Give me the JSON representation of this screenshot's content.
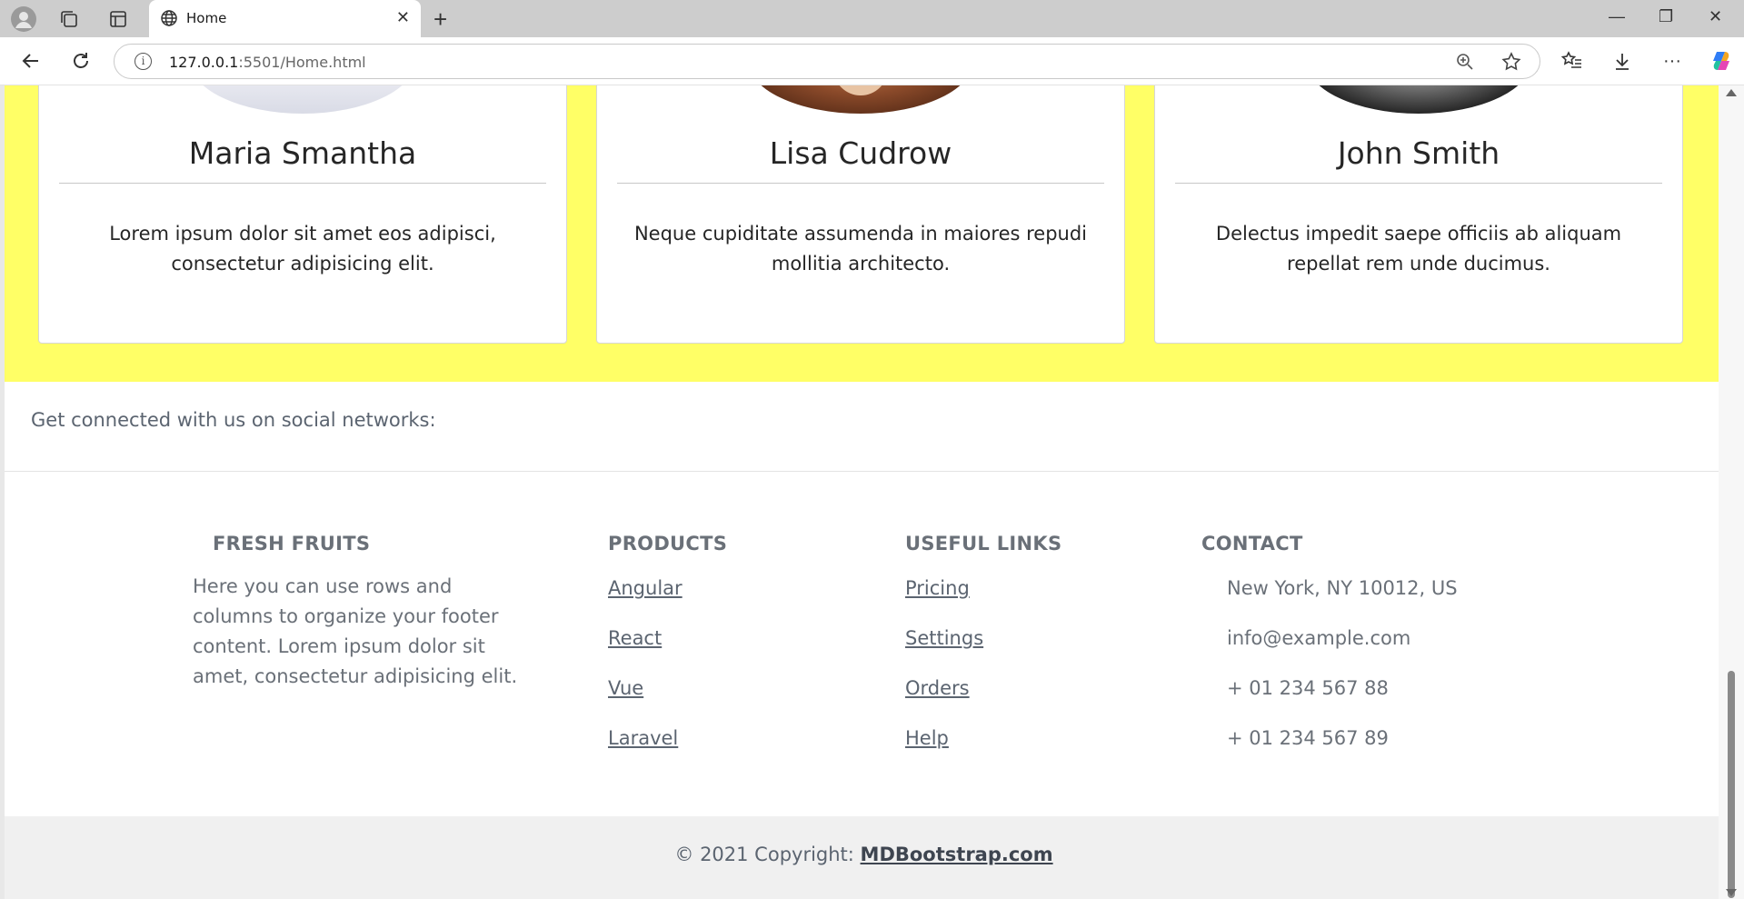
{
  "browser": {
    "tab_title": "Home",
    "url_host": "127.0.0.1",
    "url_rest": ":5501/Home.html"
  },
  "testimonials": [
    {
      "name": "Maria Smantha",
      "text": "Lorem ipsum dolor sit amet eos adipisci, consectetur adipisicing elit."
    },
    {
      "name": "Lisa Cudrow",
      "text": "Neque cupiditate assumenda in maiores repudi mollitia architecto."
    },
    {
      "name": "John Smith",
      "text": "Delectus impedit saepe officiis ab aliquam repellat rem unde ducimus."
    }
  ],
  "social": {
    "text": "Get connected with us on social networks:"
  },
  "footer": {
    "brand": {
      "heading": "FRESH FRUITS",
      "text": "Here you can use rows and columns to organize your footer content. Lorem ipsum dolor sit amet, consectetur adipisicing elit."
    },
    "products": {
      "heading": "PRODUCTS",
      "links": [
        "Angular",
        "React",
        "Vue",
        "Laravel"
      ]
    },
    "useful": {
      "heading": "USEFUL LINKS",
      "links": [
        "Pricing",
        "Settings",
        "Orders",
        "Help"
      ]
    },
    "contact": {
      "heading": "CONTACT",
      "items": [
        "New York, NY 10012, US",
        "info@example.com",
        "+ 01 234 567 88",
        "+ 01 234 567 89"
      ]
    }
  },
  "copyright": {
    "prefix": "© 2021 Copyright: ",
    "brand": "MDBootstrap.com"
  },
  "colors": {
    "yellow_band": "#ffff66",
    "copyright_bg": "#f0f0f0"
  }
}
